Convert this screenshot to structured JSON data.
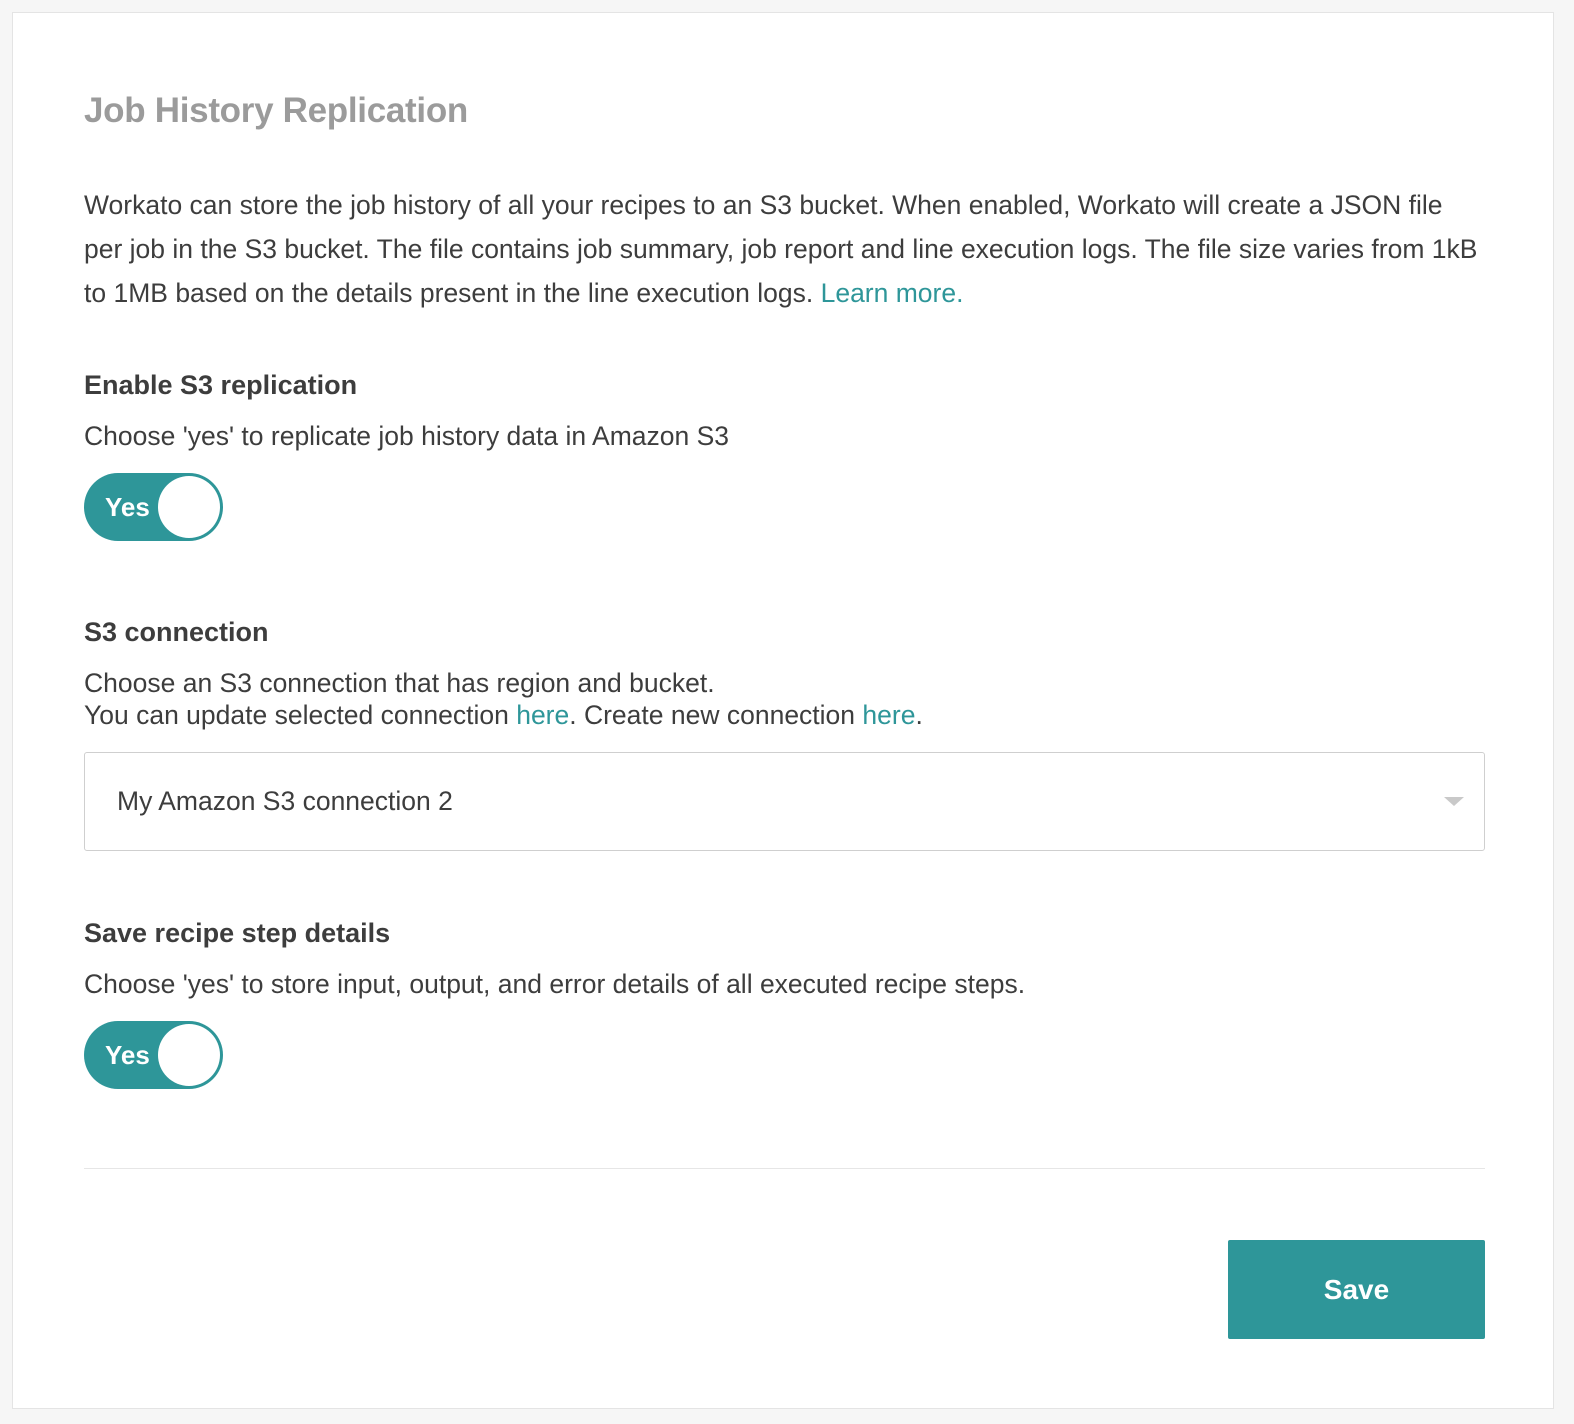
{
  "page": {
    "title": "Job History Replication",
    "description": "Workato can store the job history of all your recipes to an S3 bucket. When enabled, Workato will create a JSON file per job in the S3 bucket. The file contains job summary, job report and line execution logs. The file size varies from 1kB to 1MB based on the details present in the line execution logs.",
    "learn_more_label": "Learn more."
  },
  "enable_replication": {
    "title": "Enable S3 replication",
    "help": "Choose 'yes' to replicate job history data in Amazon S3",
    "toggle_label": "Yes",
    "enabled": true
  },
  "s3_connection": {
    "title": "S3 connection",
    "help_line1": "Choose an S3 connection that has region and bucket.",
    "help_line2_prefix": "You can update selected connection",
    "update_link_label": "here",
    "help_line2_middle": ". Create new connection",
    "create_link_label": "here",
    "help_line2_suffix": ".",
    "selected_value": "My Amazon S3 connection 2"
  },
  "save_step_details": {
    "title": "Save recipe step details",
    "help": "Choose 'yes' to store input, output, and error details of all executed recipe steps.",
    "toggle_label": "Yes",
    "enabled": true
  },
  "footer": {
    "save_label": "Save"
  },
  "colors": {
    "accent": "#2e9699",
    "title_gray": "#9b9b9b",
    "text": "#3d3d3d"
  },
  "icons": {
    "select_caret": "chevron-down-icon"
  }
}
